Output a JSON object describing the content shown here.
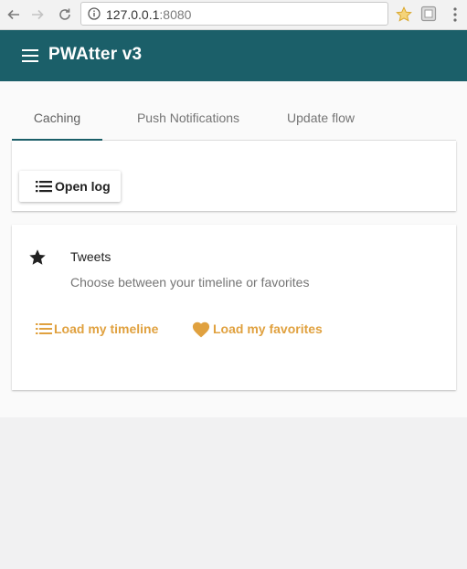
{
  "browser": {
    "url_host": "127.0.0.1",
    "url_port": ":8080"
  },
  "app": {
    "title": "PWAtter v3"
  },
  "tabs": [
    {
      "label": "Caching",
      "active": true
    },
    {
      "label": "Push Notifications",
      "active": false
    },
    {
      "label": "Update flow",
      "active": false
    }
  ],
  "log_card": {
    "open_log_label": "Open log"
  },
  "tweets_card": {
    "title": "Tweets",
    "subtitle": "Choose between your timeline or favorites",
    "load_timeline_label": "Load my timeline",
    "load_favorites_label": "Load my favorites"
  },
  "icons": {
    "menu": "hamburger-menu-icon",
    "list": "list-icon",
    "star": "star-icon",
    "heart": "heart-icon"
  },
  "colors": {
    "app_bar": "#1b5f69",
    "accent": "#e0a13f",
    "tab_indicator": "#1b5f69"
  }
}
